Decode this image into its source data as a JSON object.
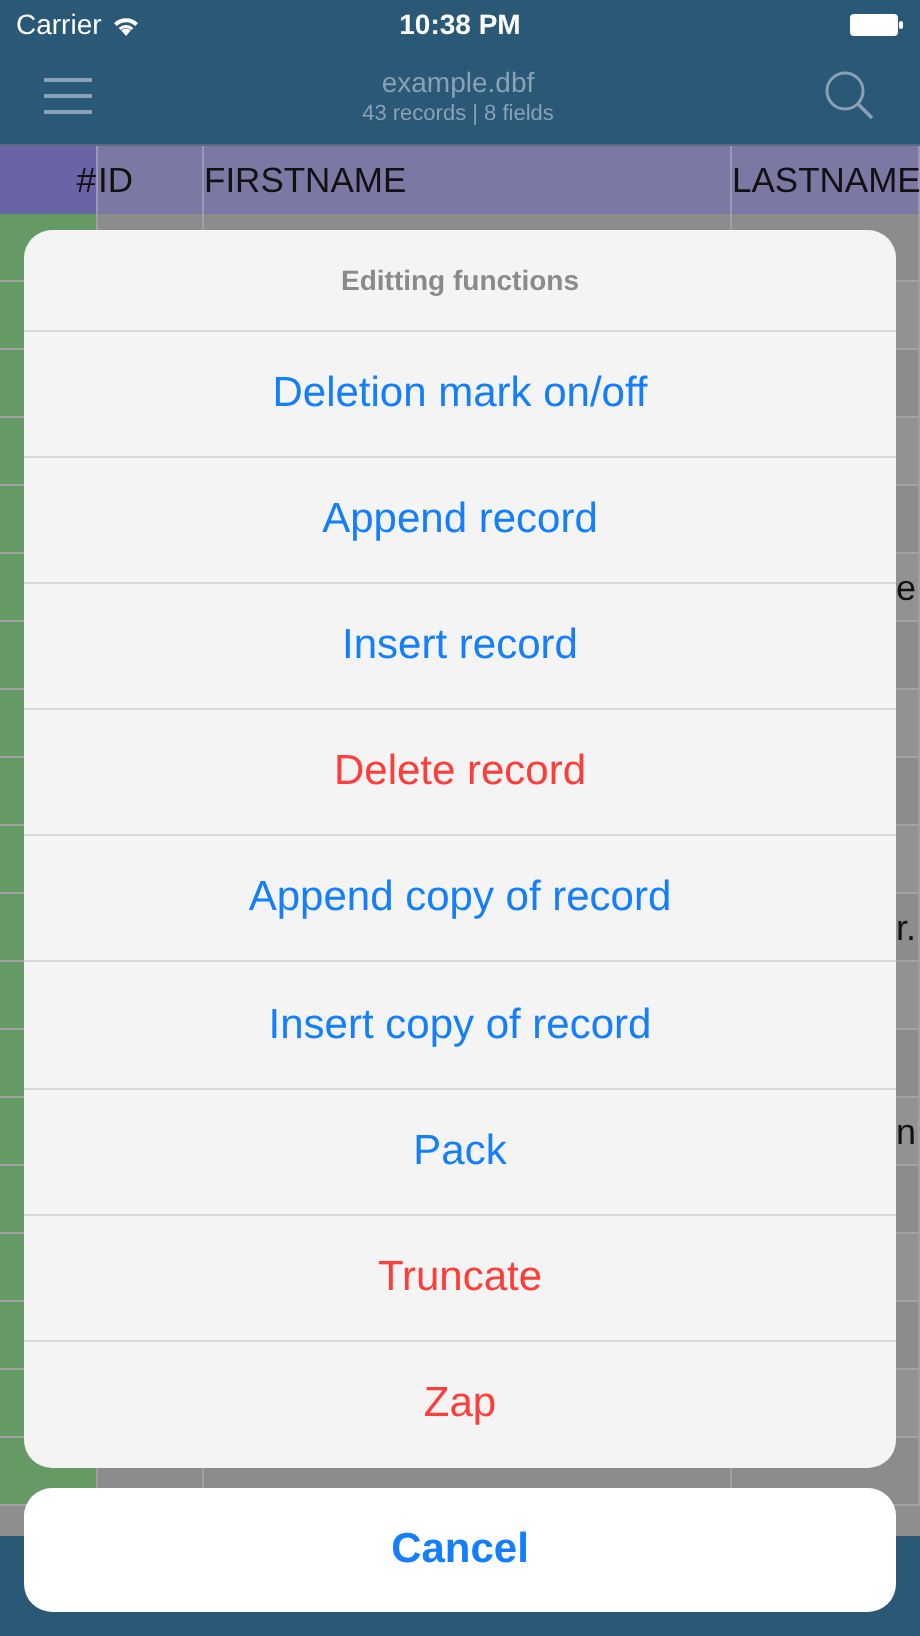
{
  "status_bar": {
    "carrier": "Carrier",
    "time": "10:38 PM"
  },
  "nav_bar": {
    "title": "example.dbf",
    "subtitle": "43 records | 8 fields"
  },
  "table": {
    "columns": [
      "#",
      "ID",
      "FIRSTNAME",
      "LASTNAME"
    ],
    "rows": [
      {
        "kind": "partial",
        "lastname": "e"
      },
      {
        "kind": "partial",
        "lastname": "r."
      },
      {
        "kind": "partial",
        "lastname": "n"
      }
    ]
  },
  "action_sheet": {
    "title": "Editting functions",
    "actions": [
      {
        "label": "Deletion mark on/off",
        "kind": "default"
      },
      {
        "label": "Append record",
        "kind": "default"
      },
      {
        "label": "Insert record",
        "kind": "default"
      },
      {
        "label": "Delete record",
        "kind": "destructive"
      },
      {
        "label": "Append copy of record",
        "kind": "default"
      },
      {
        "label": "Insert copy of record",
        "kind": "default"
      },
      {
        "label": "Pack",
        "kind": "default"
      },
      {
        "label": "Truncate",
        "kind": "destructive"
      },
      {
        "label": "Zap",
        "kind": "destructive"
      }
    ],
    "cancel": "Cancel"
  }
}
